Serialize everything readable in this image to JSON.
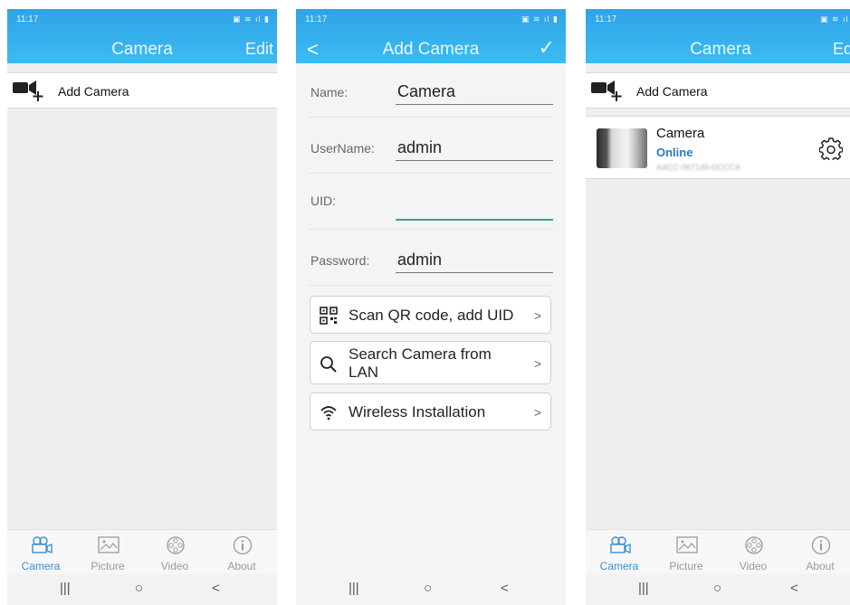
{
  "status": {
    "time": "11:17",
    "icons": "▣ ≋ ıl ▮"
  },
  "screen1": {
    "title": "Camera",
    "edit": "Edit",
    "add_camera": "Add Camera"
  },
  "screen2": {
    "title": "Add Camera",
    "back": "<",
    "confirm": "✓",
    "fields": [
      {
        "label": "Name:",
        "value": "Camera"
      },
      {
        "label": "UserName:",
        "value": "admin"
      },
      {
        "label": "UID:",
        "value": ""
      },
      {
        "label": "Password:",
        "value": "admin"
      }
    ],
    "actions": [
      {
        "label": "Scan QR code, add UID",
        "icon": "qr-code-icon"
      },
      {
        "label": "Search Camera from LAN",
        "icon": "search-icon"
      },
      {
        "label": "Wireless Installation",
        "icon": "wifi-icon"
      }
    ]
  },
  "screen3": {
    "title": "Camera",
    "edit": "Edit",
    "add_camera": "Add Camera",
    "device": {
      "name": "Camera",
      "status": "Online",
      "uid": "AACC-067149-DCCCA"
    }
  },
  "tabs": [
    "Camera",
    "Picture",
    "Video",
    "About"
  ],
  "nav": {
    "recent": "|||",
    "home": "○",
    "back": "<"
  },
  "colors": {
    "bar_top": "#2fa3e6",
    "accent_tab": "#3a8fd6",
    "online": "#2d76c7",
    "uid_focus": "#3aa39a"
  }
}
